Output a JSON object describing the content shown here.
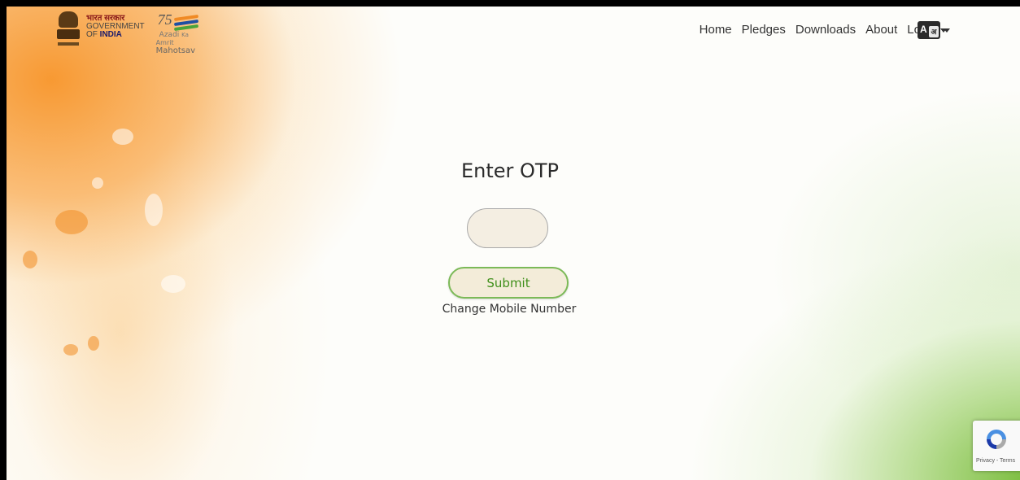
{
  "header": {
    "goi_hindi": "भारत सरकार",
    "goi_line1": "GOVERNMENT",
    "goi_of": "OF ",
    "goi_india": "INDIA",
    "akam_number": "75",
    "akam_line1": "Azadi",
    "akam_ka": "Ka",
    "akam_line2": "Amrit",
    "akam_line3": "Mahotsav"
  },
  "nav": {
    "home": "Home",
    "pledges": "Pledges",
    "downloads": "Downloads",
    "about": "About",
    "login": "Login",
    "lang_a": "A",
    "lang_b": "अ"
  },
  "main": {
    "title": "Enter OTP",
    "otp_value": "",
    "submit_label": "Submit",
    "change_mobile": "Change Mobile Number"
  },
  "recaptcha": {
    "text": "Privacy - Terms"
  },
  "colors": {
    "saffron": "#f79428",
    "green": "#73b932",
    "submit_text": "#3f8f1a"
  }
}
